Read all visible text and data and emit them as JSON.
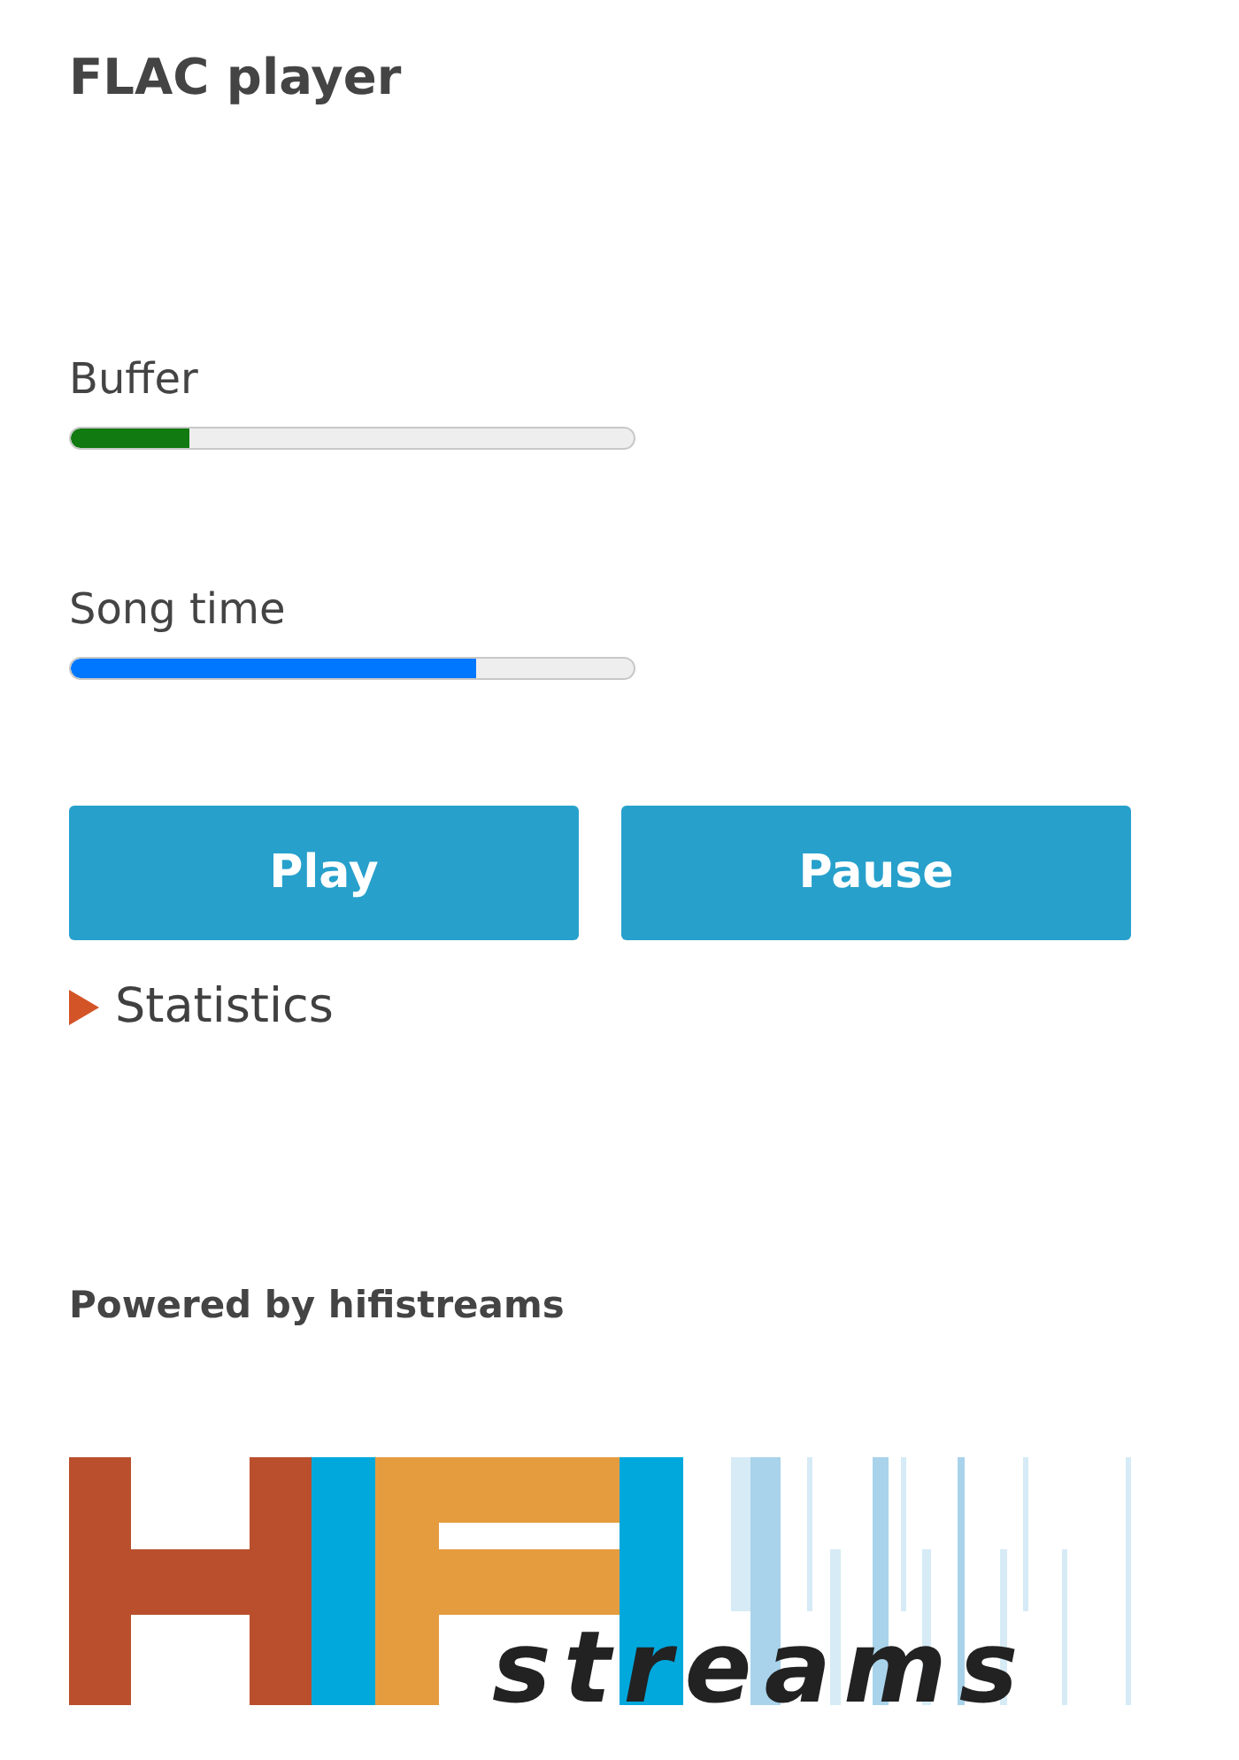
{
  "title": "FLAC player",
  "meters": [
    {
      "label": "Buffer",
      "level": 0.21,
      "color": "#117a11"
    },
    {
      "label": "Song time",
      "level": 0.72,
      "color": "#0077ff"
    }
  ],
  "buttons": [
    "Play",
    "Pause"
  ],
  "statistics": {
    "label": "Statistics",
    "expanded": false
  },
  "footer": {
    "heading": "Powered by hifistreams",
    "logo": {
      "wordmark": "streams"
    }
  }
}
